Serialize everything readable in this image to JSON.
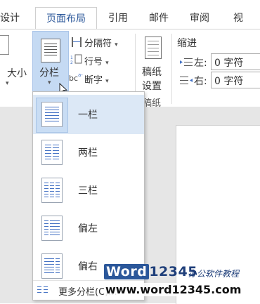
{
  "tabs": [
    {
      "label": "设计"
    },
    {
      "label": "页面布局"
    },
    {
      "label": "引用"
    },
    {
      "label": "邮件"
    },
    {
      "label": "审阅"
    },
    {
      "label": "视"
    }
  ],
  "ribbon": {
    "size_label": "大小",
    "columns_label": "分栏",
    "breaks_label": "分隔符",
    "line_numbers_label": "行号",
    "hyphenation_label": "断字",
    "manuscript_line1": "稿纸",
    "manuscript_line2": "设置",
    "manuscript_group": "稿纸",
    "indent_group": "缩进",
    "left_label": "左:",
    "right_label": "右:",
    "left_value": "0 字符",
    "right_value": "0 字符"
  },
  "dropdown": {
    "items": [
      {
        "label": "一栏",
        "icon": "one-column-icon"
      },
      {
        "label": "两栏",
        "icon": "two-columns-icon"
      },
      {
        "label": "三栏",
        "icon": "three-columns-icon"
      },
      {
        "label": "偏左",
        "icon": "left-column-icon"
      },
      {
        "label": "偏右",
        "icon": "right-column-icon"
      }
    ],
    "more_label": "更多分栏(C)..."
  },
  "watermark": {
    "brand_word": "Word",
    "brand_num": "12345",
    "tagline": "办公软件教程",
    "url": "www.word12345.com"
  },
  "colors": {
    "accent": "#2b579a",
    "highlight": "#c9ddf4",
    "line": "#4472c4"
  }
}
